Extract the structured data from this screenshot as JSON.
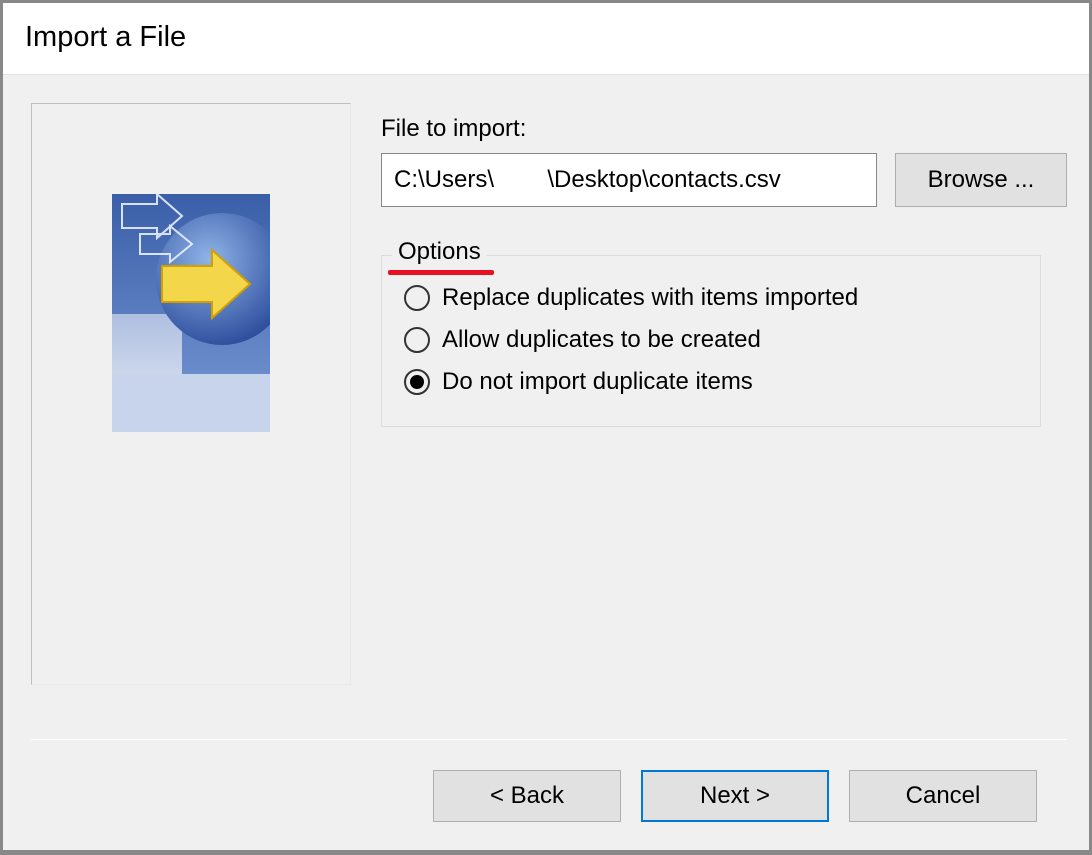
{
  "dialog": {
    "title": "Import a File"
  },
  "form": {
    "file_label": "File to import:",
    "file_value": "C:\\Users\\        \\Desktop\\contacts.csv",
    "browse_label": "Browse ..."
  },
  "options": {
    "legend": "Options",
    "items": [
      {
        "label": "Replace duplicates with items imported",
        "selected": false
      },
      {
        "label": "Allow duplicates to be created",
        "selected": false
      },
      {
        "label": "Do not import duplicate items",
        "selected": true
      }
    ]
  },
  "buttons": {
    "back": "< Back",
    "next": "Next >",
    "cancel": "Cancel"
  },
  "annotation": {
    "underline_color": "#e81123"
  }
}
